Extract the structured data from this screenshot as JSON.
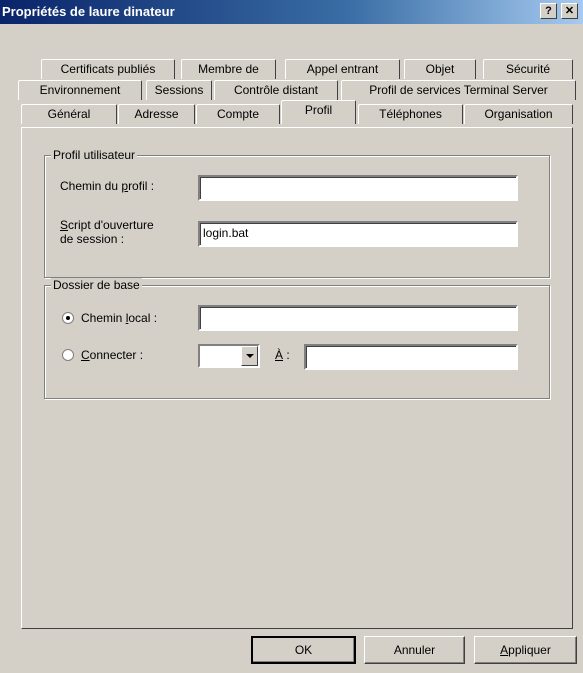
{
  "window": {
    "title": "Propriétés de laure dinateur",
    "help_label": "?",
    "close_label": "✕"
  },
  "tabs": {
    "row1": [
      "Certificats publiés",
      "Membre de",
      "Appel entrant",
      "Objet",
      "Sécurité"
    ],
    "row2": [
      "Environnement",
      "Sessions",
      "Contrôle distant",
      "Profil de services Terminal Server"
    ],
    "row3": [
      "Général",
      "Adresse",
      "Compte",
      "Profil",
      "Téléphones",
      "Organisation"
    ],
    "active": "Profil"
  },
  "profile": {
    "group_label": "Profil utilisateur",
    "profile_path_label_prefix": "Chemin du ",
    "profile_path_label_ul": "p",
    "profile_path_label_suffix": "rofil :",
    "profile_path_value": "",
    "logon_script_label_ul": "S",
    "logon_script_label_line1_rest": "cript d'ouverture",
    "logon_script_label_line2": "de session :",
    "logon_script_value": "login.bat"
  },
  "home_folder": {
    "group_label": "Dossier de base",
    "local_path_label_prefix": "Chemin ",
    "local_path_label_ul": "l",
    "local_path_label_suffix": "ocal :",
    "local_path_value": "",
    "local_path_selected": true,
    "connect_label_ul": "C",
    "connect_label_rest": "onnecter :",
    "drive_value": "",
    "to_label_ul": "À",
    "to_label_rest": " :",
    "to_value": ""
  },
  "buttons": {
    "ok": "OK",
    "cancel": "Annuler",
    "apply_ul": "A",
    "apply_rest": "ppliquer"
  }
}
